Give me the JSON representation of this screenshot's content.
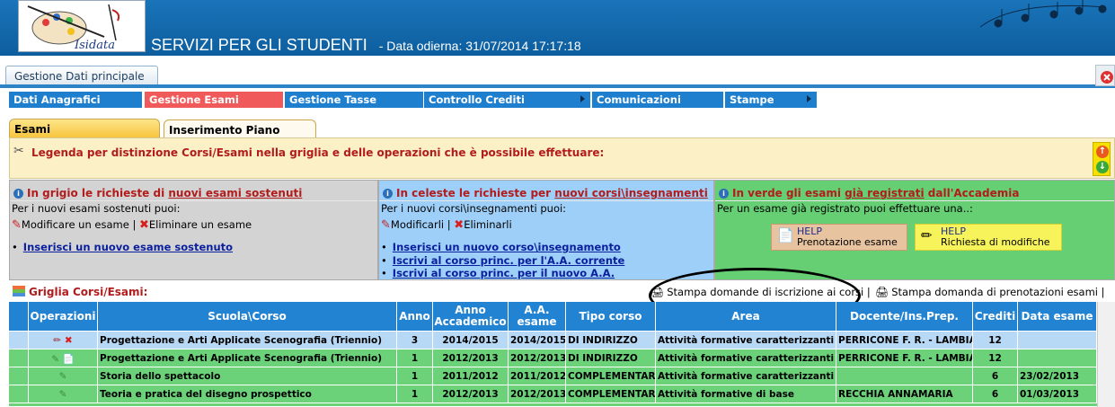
{
  "header": {
    "title": "SERVIZI PER GLI STUDENTI",
    "date_label": "- Data odierna: 31/07/2014 17:17:18",
    "logo_text": "Isidata"
  },
  "window_tab": "Gestione Dati principale",
  "menu": [
    {
      "label": "Dati Anagrafici",
      "active": false,
      "submenu": false
    },
    {
      "label": "Gestione Esami",
      "active": true,
      "submenu": false
    },
    {
      "label": "Gestione Tasse",
      "active": false,
      "submenu": false
    },
    {
      "label": "Controllo Crediti",
      "active": false,
      "submenu": true
    },
    {
      "label": "Comunicazioni",
      "active": false,
      "submenu": false
    },
    {
      "label": "Stampe",
      "active": false,
      "submenu": true
    }
  ],
  "tabs": {
    "esami": "Esami",
    "piano": "Inserimento Piano Studi"
  },
  "legend": {
    "text": "Legenda per distinzione Corsi/Esami nella griglia e delle operazioni che è possibile effettuare:"
  },
  "panel_gray": {
    "title_prefix": "In grigio le richieste di ",
    "title_link": "nuovi esami sostenuti",
    "line1": "Per i nuovi esami sostenuti puoi:",
    "modify": "Modificare un esame",
    "separator": "|",
    "delete": "Eliminare un esame",
    "link1": "Inserisci un nuovo esame sostenuto"
  },
  "panel_blue": {
    "title_prefix": "In celeste le richieste per ",
    "title_link": "nuovi corsi\\insegnamenti",
    "line1": "Per i nuovi corsi\\insegnamenti puoi:",
    "modify": "Modificarli",
    "separator": "|",
    "delete": "Eliminarli",
    "link1": "Inserisci un nuovo corso\\insegnamento",
    "link2": "Iscrivi al corso princ. per l'A.A. corrente",
    "link3": "Iscrivi al corso princ. per il nuovo A.A."
  },
  "panel_green": {
    "title_prefix": "In verde gli esami ",
    "title_link": "già registrati",
    "title_suffix": " dall'Accademia",
    "line1": "Per un esame già registrato puoi effettuare una..:",
    "help1_top": "HELP",
    "help1_label": "Prenotazione esame",
    "help2_top": "HELP",
    "help2_label": "Richiesta di modifiche"
  },
  "grid": {
    "title": "Griglia Corsi/Esami:",
    "print1": "Stampa domande di iscrizione ai corsi",
    "print2": "Stampa domanda di prenotazioni esami",
    "columns": [
      "Operazioni",
      "Scuola\\Corso",
      "Anno",
      "Anno Accademico",
      "A.A. esame",
      "Tipo corso",
      "Area",
      "Docente/Ins.Prep.",
      "Crediti",
      "Data esame"
    ],
    "rows": [
      {
        "ops": "edit-delete",
        "corso": "Progettazione e Arti Applicate Scenografia (Triennio)",
        "anno": "3",
        "aa": "2014/2015",
        "aa_esame": "2014/2015",
        "tipo": "DI INDIRIZZO",
        "area": "Attività formative caratterizzanti",
        "docente": "PERRICONE F. R. - LAMBIASE",
        "crediti": "12",
        "data": "",
        "status": "selected"
      },
      {
        "ops": "register",
        "corso": "Progettazione e Arti Applicate Scenografia (Triennio)",
        "anno": "1",
        "aa": "2012/2013",
        "aa_esame": "2012/2013",
        "tipo": "DI INDIRIZZO",
        "area": "Attività formative caratterizzanti",
        "docente": "PERRICONE F. R. - LAMBIASE",
        "crediti": "12",
        "data": "",
        "status": "registered"
      },
      {
        "ops": "register",
        "corso": "Storia dello spettacolo",
        "anno": "1",
        "aa": "2011/2012",
        "aa_esame": "2011/2012",
        "tipo": "COMPLEMENTARE",
        "area": "Attività formative caratterizzanti",
        "docente": "",
        "crediti": "6",
        "data": "23/02/2013",
        "status": "registered"
      },
      {
        "ops": "register",
        "corso": "Teoria e pratica del disegno prospettico",
        "anno": "1",
        "aa": "2012/2013",
        "aa_esame": "2012/2013",
        "tipo": "COMPLEMENTARE",
        "area": "Attività formative di base",
        "docente": "RECCHIA ANNAMARIA",
        "crediti": "6",
        "data": "01/03/2013",
        "status": "registered"
      }
    ]
  }
}
